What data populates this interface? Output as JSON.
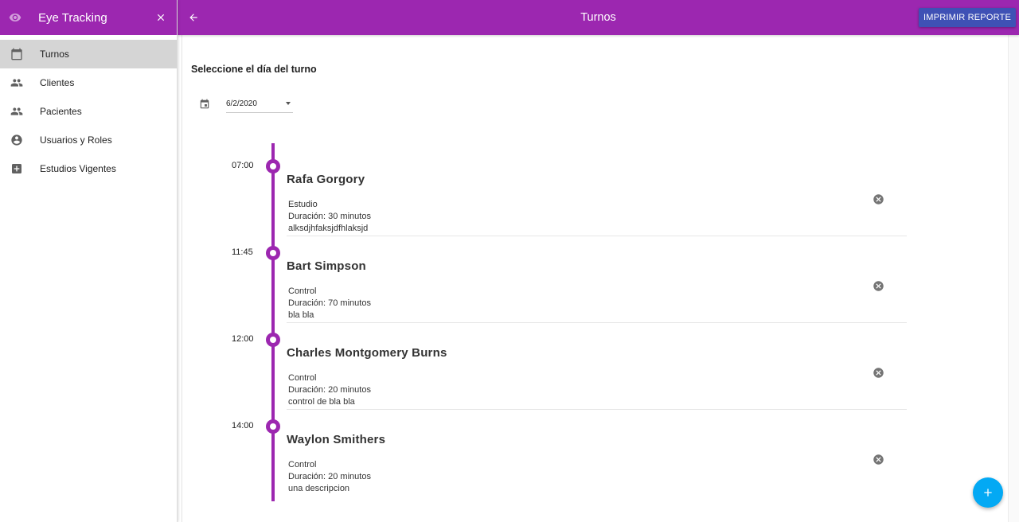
{
  "sidebar": {
    "app_title": "Eye Tracking",
    "items": [
      {
        "label": "Turnos",
        "icon": "calendar-icon",
        "active": true
      },
      {
        "label": "Clientes",
        "icon": "people-icon",
        "active": false
      },
      {
        "label": "Pacientes",
        "icon": "people-icon",
        "active": false
      },
      {
        "label": "Usuarios y Roles",
        "icon": "account-circle-icon",
        "active": false
      },
      {
        "label": "Estudios Vigentes",
        "icon": "medical-plus-icon",
        "active": false
      }
    ]
  },
  "topbar": {
    "title": "Turnos",
    "print_label": "IMPRIMIR REPORTE"
  },
  "main": {
    "section_title": "Seleccione el día del turno",
    "date_value": "6/2/2020"
  },
  "appointments": [
    {
      "time": "07:00",
      "name": "Rafa Gorgory",
      "type": "Estudio",
      "duration": "Duración: 30 minutos",
      "description": "alksdjhfaksjdfhlaksjd"
    },
    {
      "time": "11:45",
      "name": "Bart Simpson",
      "type": "Control",
      "duration": "Duración: 70 minutos",
      "description": "bla bla"
    },
    {
      "time": "12:00",
      "name": "Charles Montgomery Burns",
      "type": "Control",
      "duration": "Duración: 20 minutos",
      "description": "control de bla bla"
    },
    {
      "time": "14:00",
      "name": "Waylon Smithers",
      "type": "Control",
      "duration": "Duración: 20 minutos",
      "description": "una descripcion"
    }
  ],
  "colors": {
    "primary": "#9c27b0",
    "print_button": "#3f51b5",
    "fab": "#03a9f4",
    "active_nav": "#d5d5d5"
  }
}
